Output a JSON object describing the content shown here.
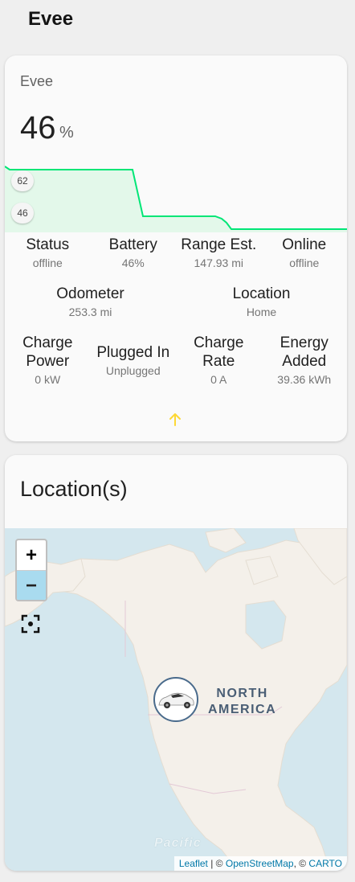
{
  "page": {
    "title": "Evee"
  },
  "sensor_card": {
    "name": "Evee",
    "level": "46",
    "unit": "%",
    "graph_labels": [
      "62",
      "46"
    ],
    "row1": [
      {
        "name": "Status",
        "value": "offline"
      },
      {
        "name": "Battery",
        "value": "46%"
      },
      {
        "name": "Range Est.",
        "value": "147.93 mi"
      },
      {
        "name": "Online",
        "value": "offline"
      }
    ],
    "row2": [
      {
        "name": "Odometer",
        "value": "253.3 mi"
      },
      {
        "name": "Location",
        "value": "Home"
      }
    ],
    "row3": [
      {
        "name1": "Charge",
        "name2": "Power",
        "value": "0 kW"
      },
      {
        "name1": "Plugged In",
        "name2": "",
        "value": "Unplugged"
      },
      {
        "name1": "Charge",
        "name2": "Rate",
        "value": "0 A"
      },
      {
        "name1": "Energy",
        "name2": "Added",
        "value": "39.36 kWh"
      }
    ],
    "accent_color": "#fdd835",
    "graph_color": "#00e676"
  },
  "map_card": {
    "title": "Location(s)",
    "zoom_in_label": "+",
    "zoom_out_label": "−",
    "region_label_1": "NORTH",
    "region_label_2": "AMERICA",
    "ocean_label": "Pacific",
    "attribution": {
      "leaflet": "Leaflet",
      "sep1": " | © ",
      "osm": "OpenStreetMap",
      "sep2": ", © ",
      "carto": "CARTO"
    }
  }
}
